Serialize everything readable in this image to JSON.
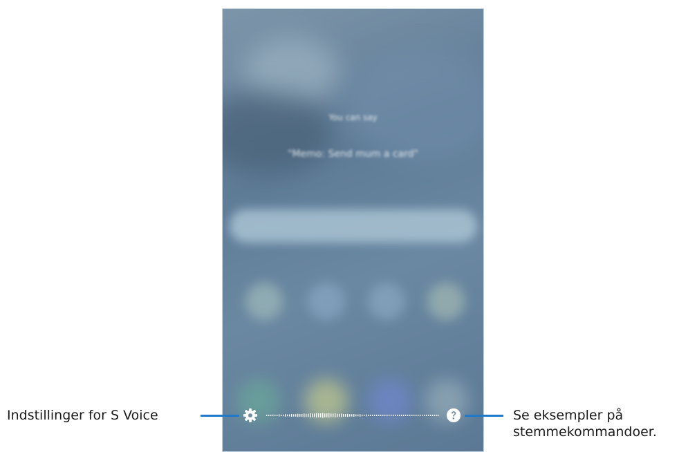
{
  "screen": {
    "hint_line_1": "You can say",
    "hint_line_2": "\"Memo: Send mum a card\""
  },
  "controls": {
    "settings_icon": "gear-icon",
    "help_icon": "question-circle-icon",
    "waveform": "voice-level-waveform"
  },
  "callouts": {
    "settings_label": "Indstillinger for S Voice",
    "help_label_line_1": "Se eksempler på",
    "help_label_line_2": "stemmekommandoer."
  },
  "colors": {
    "callout_line": "#1f78c8",
    "icon": "#ffffff"
  }
}
